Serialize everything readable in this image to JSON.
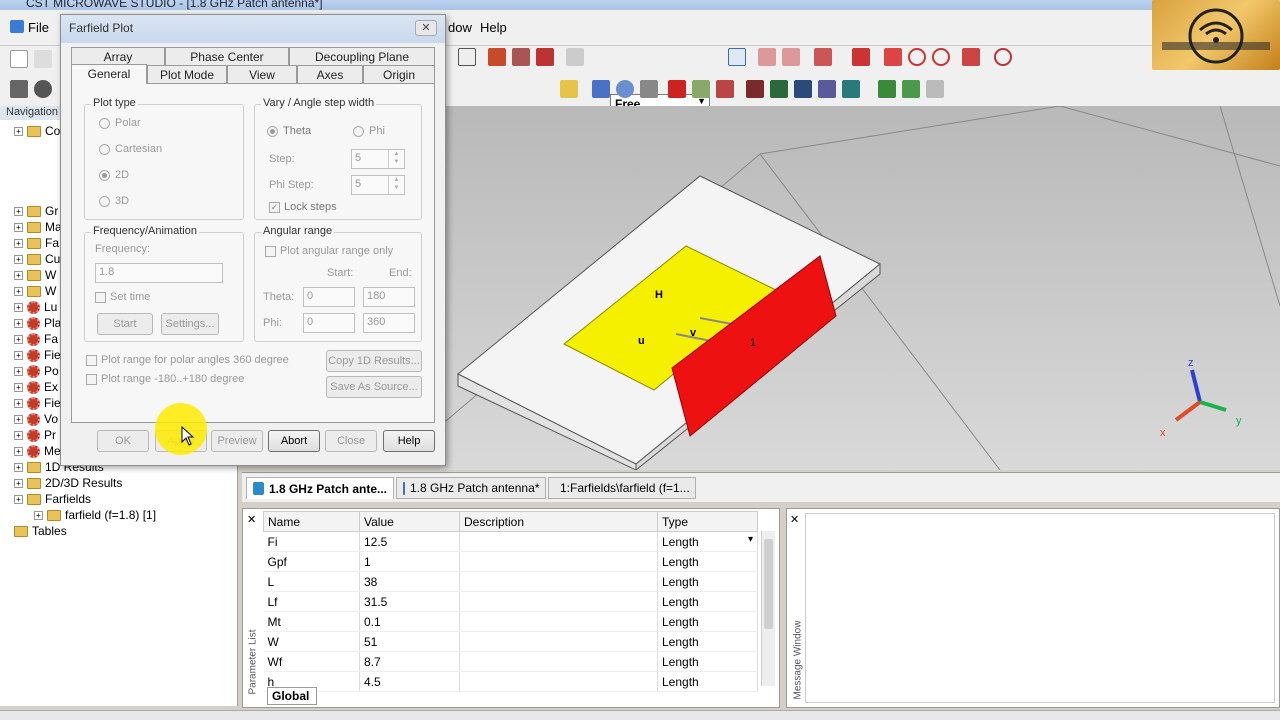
{
  "app": {
    "title": "CST MICROWAVE STUDIO - [1.8 GHz Patch antenna*]"
  },
  "menu": {
    "file": "File",
    "window": "dow",
    "help": "Help"
  },
  "toolbar": {
    "view_mode": "Free"
  },
  "navigation": {
    "header": "Navigation",
    "tree": [
      {
        "label": "Co"
      },
      {
        "label": "Gr"
      },
      {
        "label": "Ma"
      },
      {
        "label": "Fa"
      },
      {
        "label": "Cu"
      },
      {
        "label": "W"
      },
      {
        "label": "W"
      },
      {
        "label": "Lu"
      },
      {
        "label": "Pla"
      },
      {
        "label": "Fa"
      },
      {
        "label": "Fie"
      },
      {
        "label": "Po"
      },
      {
        "label": "Ex"
      },
      {
        "label": "Fie"
      },
      {
        "label": "Vo"
      },
      {
        "label": "Pr"
      },
      {
        "label": "Me"
      },
      {
        "label": "1D Results"
      },
      {
        "label": "2D/3D Results"
      },
      {
        "label": "Farfields"
      },
      {
        "label": "farfield (f=1.8) [1]"
      },
      {
        "label": "Tables"
      }
    ]
  },
  "dialog": {
    "title": "Farfield Plot",
    "close_symbol": "✕",
    "tabs_row1": [
      "Array",
      "Phase Center",
      "Decoupling Plane"
    ],
    "tabs_row2": [
      "General",
      "Plot Mode",
      "View",
      "Axes",
      "Origin"
    ],
    "plot_type": {
      "label": "Plot type",
      "options": [
        "Polar",
        "Cartesian",
        "2D",
        "3D"
      ]
    },
    "vary": {
      "label": "Vary / Angle step width",
      "theta": "Theta",
      "phi": "Phi",
      "step_label": "Step:",
      "step_value": "5",
      "phi_step_label": "Phi Step:",
      "phi_step_value": "5",
      "lock": "Lock steps"
    },
    "freq": {
      "label": "Frequency/Animation",
      "frequency_label": "Frequency:",
      "frequency_value": "1.8",
      "set_time": "Set time",
      "start": "Start",
      "settings": "Settings..."
    },
    "angular": {
      "label": "Angular range",
      "plot_only": "Plot angular range only",
      "start_label": "Start:",
      "end_label": "End:",
      "theta_label": "Theta:",
      "theta_start": "0",
      "theta_end": "180",
      "phi_label": "Phi:",
      "phi_start": "0",
      "phi_end": "360"
    },
    "opt_polar360": "Plot range for polar angles 360 degree",
    "opt_range180": "Plot range -180..+180 degree",
    "copy_1d": "Copy 1D Results...",
    "save_source": "Save As Source...",
    "buttons": {
      "ok": "OK",
      "apply": "Apply",
      "preview": "Preview",
      "abort": "Abort",
      "close": "Close",
      "help": "Help"
    }
  },
  "viewport": {
    "labels": {
      "h": "H",
      "u": "u",
      "v": "v",
      "port": "1"
    },
    "axes": {
      "z": "z",
      "x": "x",
      "y": "y"
    }
  },
  "bottom_tabs": [
    {
      "label": "1.8 GHz Patch ante..."
    },
    {
      "label": "1.8 GHz Patch antenna*"
    },
    {
      "label": "1:Farfields\\farfield (f=1..."
    }
  ],
  "param_list": {
    "side_label": "Parameter List",
    "columns": [
      "Name",
      "Value",
      "Description",
      "Type"
    ],
    "rows": [
      {
        "name": "Fi",
        "value": "12.5",
        "description": "",
        "type": "Length"
      },
      {
        "name": "Gpf",
        "value": "1",
        "description": "",
        "type": "Length"
      },
      {
        "name": "L",
        "value": "38",
        "description": "",
        "type": "Length"
      },
      {
        "name": "Lf",
        "value": "31.5",
        "description": "",
        "type": "Length"
      },
      {
        "name": "Mt",
        "value": "0.1",
        "description": "",
        "type": "Length"
      },
      {
        "name": "W",
        "value": "51",
        "description": "",
        "type": "Length"
      },
      {
        "name": "Wf",
        "value": "8.7",
        "description": "",
        "type": "Length"
      },
      {
        "name": "h",
        "value": "4.5",
        "description": "",
        "type": "Length"
      }
    ],
    "tab": "Global"
  },
  "message_window": {
    "side_label": "Message Window"
  },
  "colors": {
    "patch": "#f5f000",
    "port": "#ee1111",
    "substrate": "#f4f4f4"
  }
}
